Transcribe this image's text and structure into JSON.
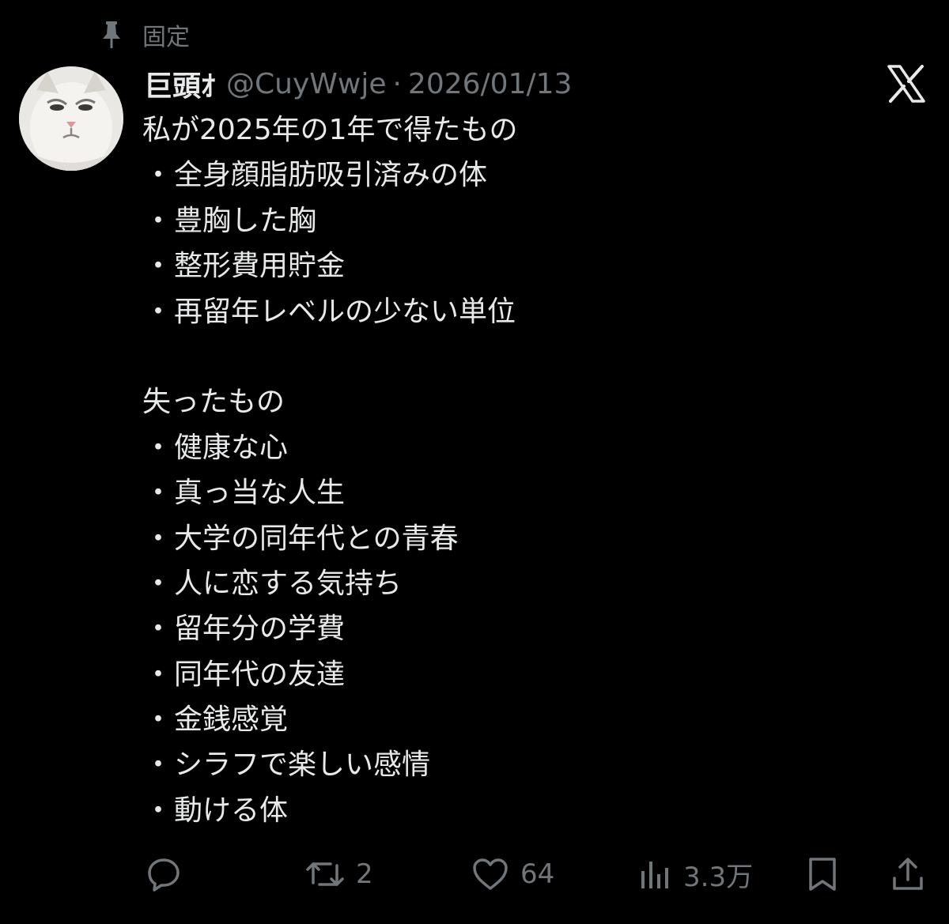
{
  "pinned": {
    "label": "固定",
    "icon": "pin-icon"
  },
  "tweet": {
    "avatar_icon": "cat-face-avatar",
    "display_name": "巨頭ｵ",
    "handle": "@CuyWwje",
    "separator": "·",
    "date": "2026/01/13",
    "gained_heading": "私が2025年の1年で得たもの",
    "gained": [
      "全身顔脂肪吸引済みの体",
      "豊胸した胸",
      "整形費用貯金",
      "再留年レベルの少ない単位"
    ],
    "lost_heading": "失ったもの",
    "lost": [
      "健康な心",
      "真っ当な人生",
      "大学の同年代との青春",
      "人に恋する気持ち",
      "留年分の学費",
      "同年代の友達",
      "金銭感覚",
      "シラフで楽しい感情",
      "動ける体"
    ],
    "bullet": "・"
  },
  "brand": {
    "logo_icon": "x-logo-icon"
  },
  "actions": {
    "reply": {
      "icon": "reply-icon",
      "count": ""
    },
    "repost": {
      "icon": "repost-icon",
      "count": "2"
    },
    "like": {
      "icon": "heart-icon",
      "count": "64"
    },
    "views": {
      "icon": "views-icon",
      "count": "3.3万"
    },
    "bookmark": {
      "icon": "bookmark-icon"
    },
    "share": {
      "icon": "share-icon"
    }
  },
  "colors": {
    "background": "#000000",
    "primary_text": "#e7e9ea",
    "secondary_text": "#71767b"
  }
}
